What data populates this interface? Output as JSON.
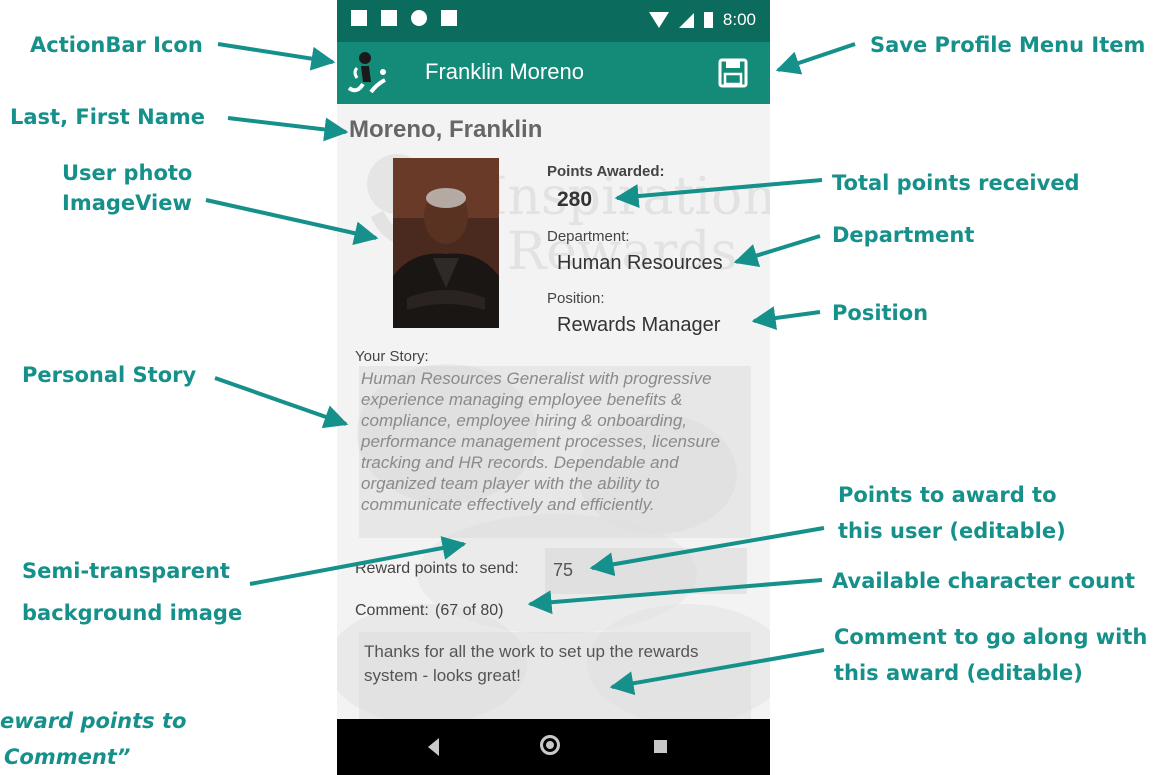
{
  "annotations": {
    "actionbar_icon": "ActionBar Icon",
    "save_menu_item": "Save Profile Menu Item",
    "last_first_name": "Last, First Name",
    "user_photo_line1": "User photo",
    "user_photo_line2": "ImageView",
    "total_points": "Total points received",
    "department": "Department",
    "position": "Position",
    "personal_story": "Personal Story",
    "points_to_award_line1": "Points to award to",
    "points_to_award_line2": "this user (editable)",
    "semi_transparent_line1": "Semi-transparent",
    "semi_transparent_line2": "background image",
    "char_count": "Available character count",
    "comment_line1": "Comment to go along with",
    "comment_line2": "this award (editable)",
    "partial_line1": "eward points to",
    "partial_line2": "Comment”"
  },
  "statusbar": {
    "time": "8:00"
  },
  "actionbar": {
    "title": "Franklin Moreno",
    "save_icon": "save-icon",
    "app_icon": "app-logo-icon"
  },
  "profile": {
    "full_name": "Moreno, Franklin",
    "points_label": "Points Awarded:",
    "points_value": "280",
    "department_label": "Department:",
    "department_value": "Human Resources",
    "position_label": "Position:",
    "position_value": "Rewards Manager",
    "story_label": "Your Story:",
    "story_text": "Human Resources Generalist with progressive experience managing employee benefits & compliance, employee hiring & onboarding, performance management processes, licensure tracking and HR records. Dependable and organized team player with the ability to communicate effectively and efficiently.",
    "watermark_line1": "Inspiration",
    "watermark_line2": "Rewards"
  },
  "award": {
    "reward_label": "Reward points to send:",
    "reward_value": "75",
    "comment_label": "Comment:",
    "comment_count": "(67 of 80)",
    "comment_value": "Thanks for all the work to set up the rewards system - looks great!"
  },
  "colors": {
    "annotation": "#16908a",
    "statusbar": "#0b6b5c",
    "actionbar": "#148a78"
  }
}
